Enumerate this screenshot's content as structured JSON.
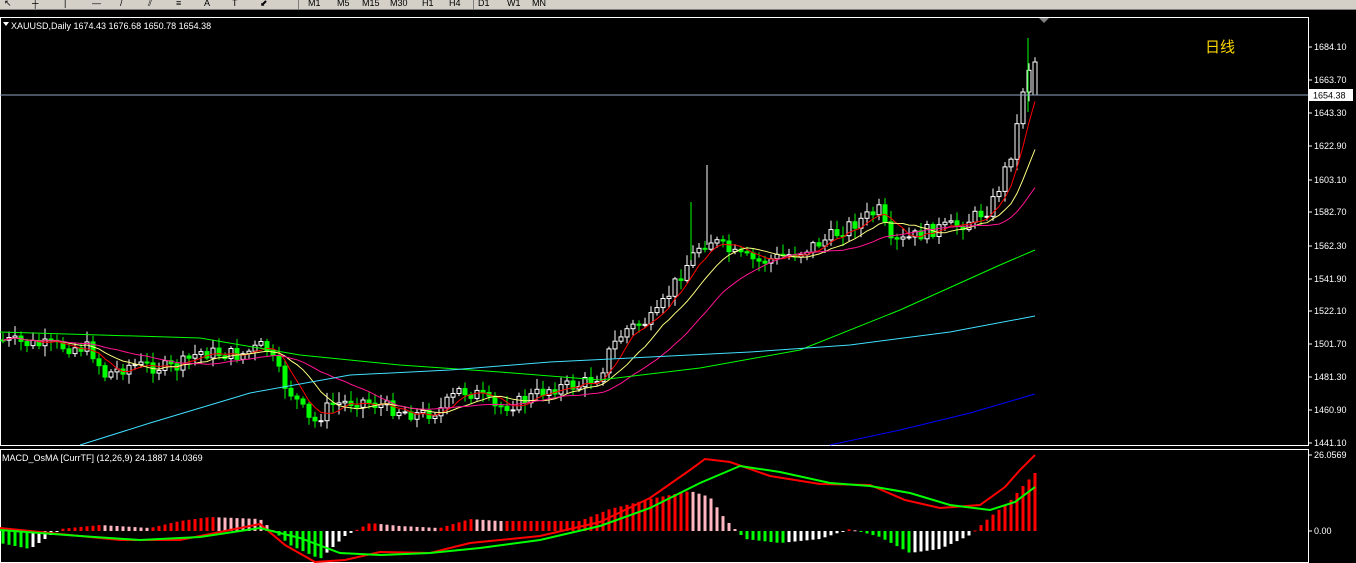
{
  "toolbar": {
    "tools": [
      {
        "name": "cursor-icon",
        "glyph": "↖"
      },
      {
        "name": "crosshair-icon",
        "glyph": "┼"
      },
      {
        "name": "vertical-line-icon",
        "glyph": "|"
      },
      {
        "name": "horizontal-line-icon",
        "glyph": "—"
      },
      {
        "name": "trendline-icon",
        "glyph": "/"
      },
      {
        "name": "equidistant-channel-icon",
        "glyph": "⫽"
      },
      {
        "name": "fibonacci-icon",
        "glyph": "≡"
      },
      {
        "name": "text-icon",
        "glyph": "A"
      },
      {
        "name": "label-icon",
        "glyph": "T"
      },
      {
        "name": "arrow-dropdown-icon",
        "glyph": "⬋"
      }
    ],
    "timeframes": [
      "M1",
      "M5",
      "M15",
      "M30",
      "H1",
      "H4",
      "D1",
      "W1",
      "MN"
    ]
  },
  "main_chart": {
    "header": "XAUUSD,Daily  1674.43 1676.68 1650.78 1654.38",
    "period_label": "日线",
    "current_price": "1654.38",
    "price_labels": [
      "1684.10",
      "1663.70",
      "1643.30",
      "1622.90",
      "1603.10",
      "1582.70",
      "1562.30",
      "1541.90",
      "1522.10",
      "1501.70",
      "1481.30",
      "1460.90",
      "1441.10"
    ]
  },
  "sub_chart": {
    "header": "MACD_OsMA [CurrTF] (12,26,9) 24.1887 14.0369",
    "price_labels": [
      "26.0569",
      "0.00"
    ]
  },
  "colors": {
    "bull_candle": "#ffffff",
    "bear_candle": "#00ff00",
    "ma_fast": "#ff0000",
    "ma_yellow": "#ffff80",
    "ma_magenta": "#ff1493",
    "ma_green": "#00ff00",
    "ma_cyan": "#40e0ff",
    "ma_blue": "#0000ff",
    "macd_line": "#ff0000",
    "signal_line": "#00ff00",
    "hist_up_strong": "#ff0000",
    "hist_up_weak": "#ffb6c1",
    "hist_down_strong": "#00ff00",
    "hist_down_weak": "#ffffff",
    "price_line": "#8fa9c7"
  }
}
